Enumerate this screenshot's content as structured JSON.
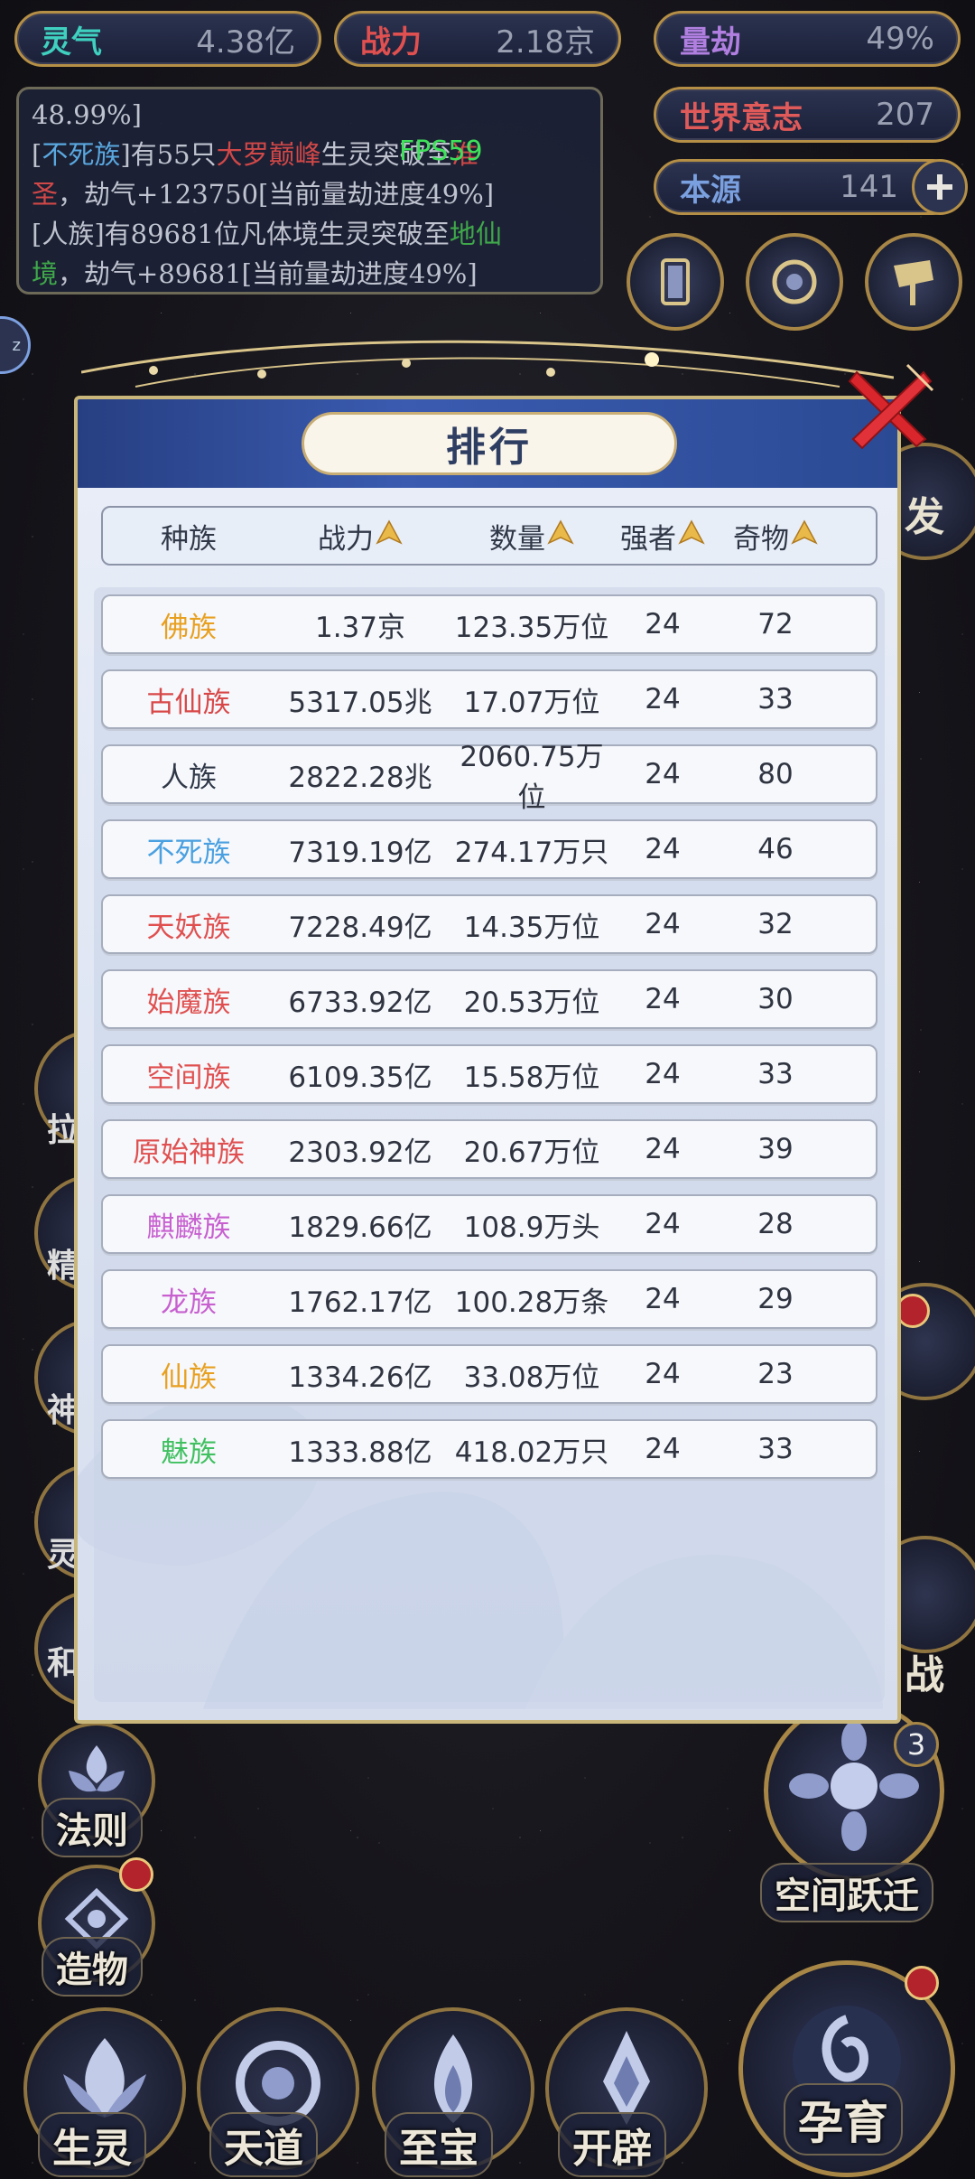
{
  "stats": {
    "lingqi": {
      "label": "灵气",
      "value": "4.38亿",
      "color": "#3fd0c0"
    },
    "zhanli": {
      "label": "战力",
      "value": "2.18京",
      "color": "#e05050"
    },
    "liangjie": {
      "label": "量劫",
      "value": "49%",
      "color": "#b07fe0"
    },
    "shijie": {
      "label": "世界意志",
      "value": "207",
      "color": "#e05a5a"
    },
    "benyuan": {
      "label": "本源",
      "value": "141",
      "color": "#7aa0e0"
    }
  },
  "log": {
    "lines": [
      {
        "segments": [
          {
            "text": "48.99%]",
            "color": "#bfc3cf"
          }
        ]
      },
      {
        "segments": [
          {
            "text": "[",
            "color": "#bfc3cf"
          },
          {
            "text": "不死族",
            "color": "#5aa8e0"
          },
          {
            "text": "]有55只",
            "color": "#bfc3cf"
          },
          {
            "text": "大罗巅峰",
            "color": "#d04848"
          },
          {
            "text": "生灵突破至",
            "color": "#bfc3cf"
          },
          {
            "text": "准",
            "color": "#d04848"
          }
        ]
      },
      {
        "segments": [
          {
            "text": "圣",
            "color": "#d04848"
          },
          {
            "text": "，劫气+123750[当前量劫进度49%]",
            "color": "#bfc3cf"
          }
        ]
      },
      {
        "segments": [
          {
            "text": "[人族]有89681位凡体境生灵突破至",
            "color": "#bfc3cf"
          },
          {
            "text": "地仙",
            "color": "#3fa84a"
          }
        ]
      },
      {
        "segments": [
          {
            "text": "境",
            "color": "#3fa84a"
          },
          {
            "text": "，劫气+89681[当前量劫进度49%]",
            "color": "#bfc3cf"
          }
        ]
      }
    ],
    "fps": "FPS59"
  },
  "modal": {
    "title": "排行",
    "headers": [
      "种族",
      "战力",
      "数量",
      "强者",
      "奇物"
    ],
    "rows": [
      {
        "name": "佛族",
        "color": "#e8a020",
        "power": "1.37京",
        "count": "123.35万位",
        "strong": "24",
        "items": "72"
      },
      {
        "name": "古仙族",
        "color": "#d84848",
        "power": "5317.05兆",
        "count": "17.07万位",
        "strong": "24",
        "items": "33"
      },
      {
        "name": "人族",
        "color": "#303848",
        "power": "2822.28兆",
        "count": "2060.75万位",
        "strong": "24",
        "items": "80"
      },
      {
        "name": "不死族",
        "color": "#4aa0e0",
        "power": "7319.19亿",
        "count": "274.17万只",
        "strong": "24",
        "items": "46"
      },
      {
        "name": "天妖族",
        "color": "#e05050",
        "power": "7228.49亿",
        "count": "14.35万位",
        "strong": "24",
        "items": "32"
      },
      {
        "name": "始魔族",
        "color": "#e05050",
        "power": "6733.92亿",
        "count": "20.53万位",
        "strong": "24",
        "items": "30"
      },
      {
        "name": "空间族",
        "color": "#e05050",
        "power": "6109.35亿",
        "count": "15.58万位",
        "strong": "24",
        "items": "33"
      },
      {
        "name": "原始神族",
        "color": "#e05050",
        "power": "2303.92亿",
        "count": "20.67万位",
        "strong": "24",
        "items": "39"
      },
      {
        "name": "麒麟族",
        "color": "#c860d0",
        "power": "1829.66亿",
        "count": "108.9万头",
        "strong": "24",
        "items": "28"
      },
      {
        "name": "龙族",
        "color": "#c860d0",
        "power": "1762.17亿",
        "count": "100.28万条",
        "strong": "24",
        "items": "29"
      },
      {
        "name": "仙族",
        "color": "#e8a020",
        "power": "1334.26亿",
        "count": "33.08万位",
        "strong": "24",
        "items": "23"
      },
      {
        "name": "魅族",
        "color": "#40c060",
        "power": "1333.88亿",
        "count": "418.02万只",
        "strong": "24",
        "items": "33"
      }
    ]
  },
  "side": {
    "right_partial_1": "发",
    "right_partial_2": "战",
    "kongjian_label": "空间跃迁",
    "kongjian_badge": "3",
    "left_partial": "z",
    "left_chars": [
      "拉",
      "精",
      "神",
      "灵",
      "和"
    ],
    "fa_ze": "法则",
    "zao_wu": "造物"
  },
  "bottom": {
    "items": [
      "生灵",
      "天道",
      "至宝",
      "开辟"
    ],
    "yun_yu": "孕育"
  }
}
